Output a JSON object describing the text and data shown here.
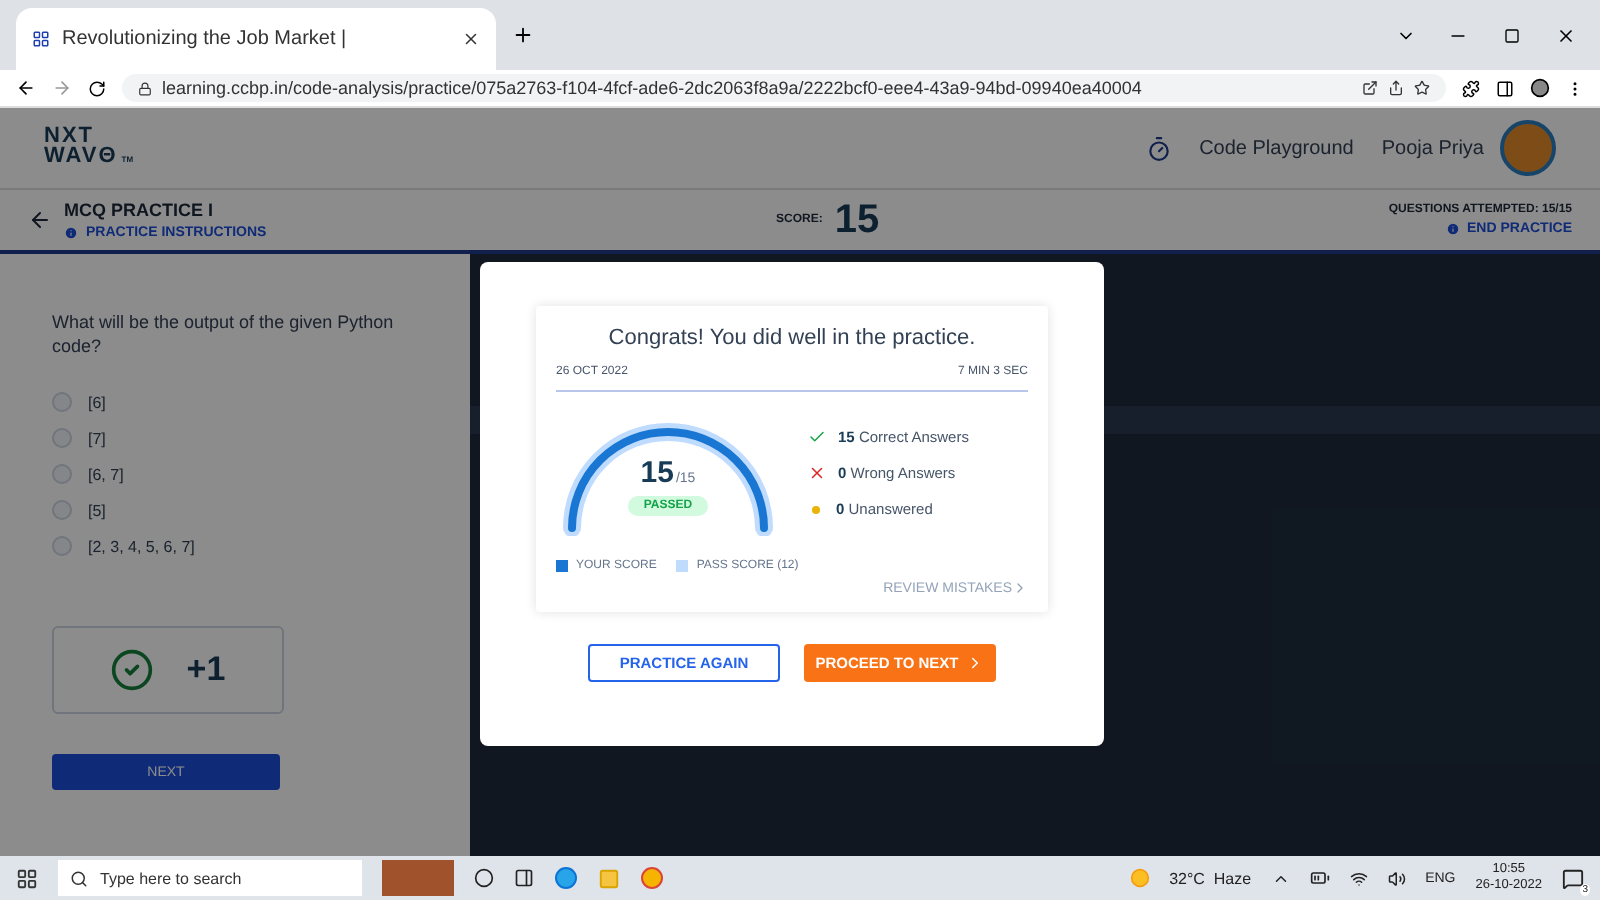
{
  "browser": {
    "tab_title": "Revolutionizing the Job Market |",
    "url": "learning.ccbp.in/code-analysis/practice/075a2763-f104-4fcf-ade6-2dc2063f8a9a/2222bcf0-eee4-43a9-94bd-09940ea40004"
  },
  "header": {
    "logo": [
      "NXT",
      "WAVΘ"
    ],
    "logo_mark": "TM",
    "nav_link": "Code Playground",
    "user_name": "Pooja Priya"
  },
  "subheader": {
    "title": "MCQ PRACTICE I",
    "instructions_link": "PRACTICE INSTRUCTIONS",
    "score_label": "SCORE:",
    "score": "15",
    "attempted": "QUESTIONS ATTEMPTED: 15/15",
    "end_link": "END PRACTICE"
  },
  "question": {
    "text": "What will be the output of the given Python code?",
    "options": [
      {
        "label": "[6]",
        "selected": false
      },
      {
        "label": "[7]",
        "selected": false
      },
      {
        "label": "[6, 7]",
        "selected": false
      },
      {
        "label": "[5]",
        "selected": false
      },
      {
        "label": "[2, 3, 4, 5, 6, 7]",
        "selected": false
      }
    ],
    "result": "+1",
    "next_button": "NEXT"
  },
  "modal": {
    "title": "Congrats! You did well in the practice.",
    "date": "26 OCT 2022",
    "duration": "7 MIN 3 SEC",
    "score": "15",
    "total": "/15",
    "status": "PASSED",
    "level": 1,
    "stats": [
      {
        "kind": "correct",
        "count": "15",
        "label": "Correct Answers"
      },
      {
        "kind": "wrong",
        "count": "0",
        "label": "Wrong Answers"
      },
      {
        "kind": "unanswered",
        "count": "0",
        "label": "Unanswered"
      }
    ],
    "legend": [
      "YOUR SCORE",
      "PASS SCORE (12)"
    ],
    "review_link": "REVIEW MISTAKES",
    "buttons": [
      {
        "kind": "outline",
        "label": "PRACTICE AGAIN"
      },
      {
        "kind": "primary",
        "label": "PROCEED TO NEXT"
      }
    ]
  },
  "taskbar": {
    "search_placeholder": "Type here to search",
    "weather": "32°C  Haze",
    "language": "ENG",
    "time": "10:55",
    "date": "26-10-2022",
    "notifications": "3"
  }
}
